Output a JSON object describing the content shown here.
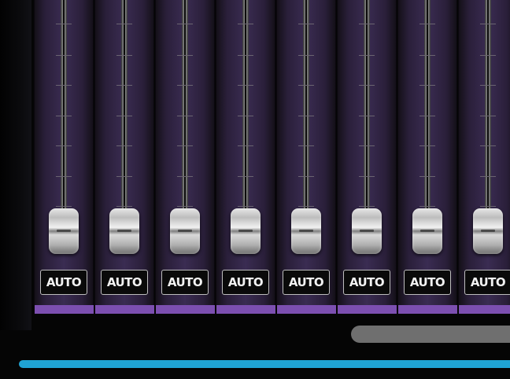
{
  "colors": {
    "background": "#050505",
    "channel_strip": "#3a2c52",
    "select_strip": "#7c4fb0",
    "scrollbar": "#6f6f6f",
    "master_bar": "#1fa3d4",
    "button_text": "#f2f2f2"
  },
  "channels": [
    {
      "auto_label": "AUTO"
    },
    {
      "auto_label": "AUTO"
    },
    {
      "auto_label": "AUTO"
    },
    {
      "auto_label": "AUTO"
    },
    {
      "auto_label": "AUTO"
    },
    {
      "auto_label": "AUTO"
    },
    {
      "auto_label": "AUTO"
    },
    {
      "auto_label": "AUTO"
    }
  ]
}
